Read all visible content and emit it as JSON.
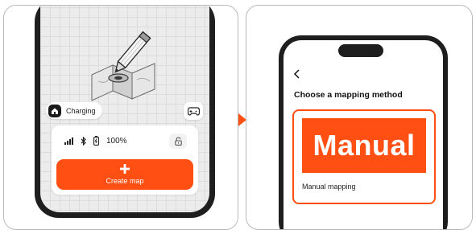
{
  "left_screen": {
    "status": {
      "charging_label": "Charging",
      "battery_text": "100%"
    },
    "create_map": {
      "label": "Create map"
    }
  },
  "right_screen": {
    "title": "Choose a mapping method",
    "method": {
      "banner_text": "Manual",
      "label": "Manual mapping"
    }
  },
  "icons": {
    "charging": "home-robot-icon",
    "gamepad": "gamepad-icon",
    "signal": "signal-bars-icon",
    "bluetooth": "bluetooth-icon",
    "battery": "battery-icon",
    "lock": "lock-icon",
    "plus": "plus-icon",
    "back": "chevron-left-icon",
    "illustration": "map-pencil-icon"
  },
  "colors": {
    "accent": "#ff4f12",
    "phone_body": "#1e1e1e",
    "map_bg": "#ececec"
  }
}
